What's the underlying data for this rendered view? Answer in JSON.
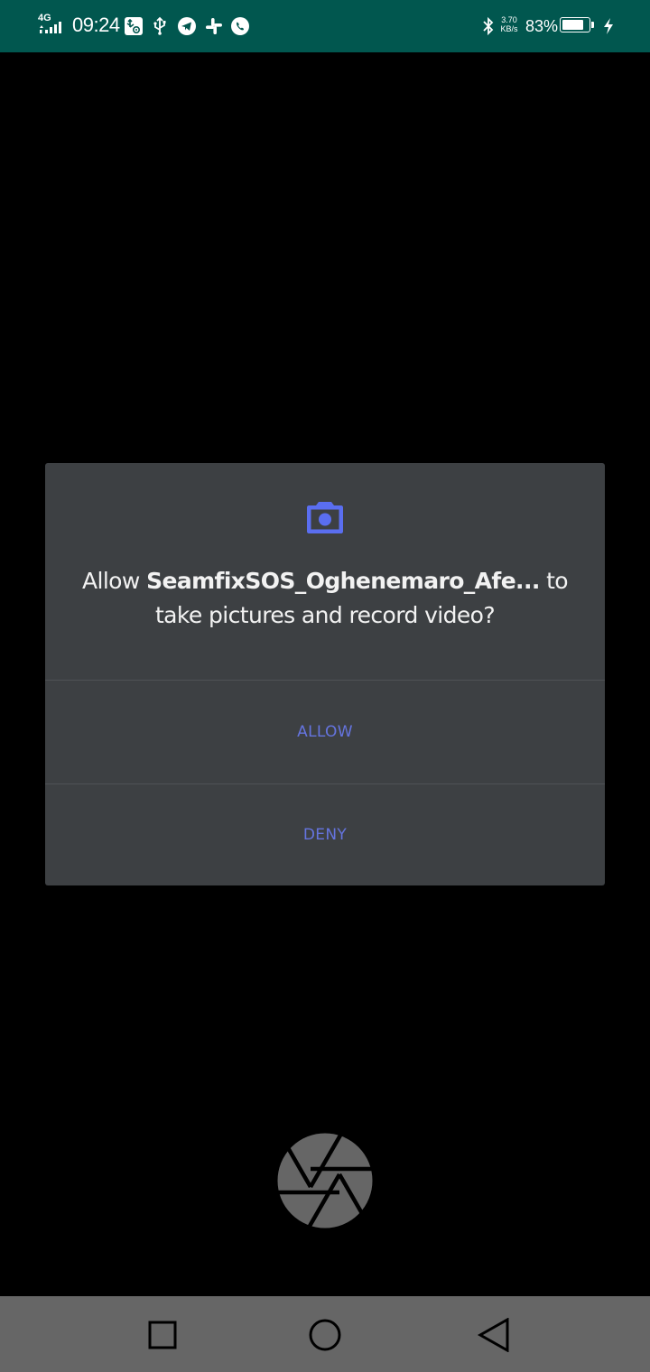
{
  "status_bar": {
    "network_type": "4G",
    "time": "09:24",
    "net_speed_value": "3.70",
    "net_speed_unit": "KB/s",
    "battery_percent": "83%",
    "battery_level": 0.83,
    "background_color": "#01574f",
    "notification_icons": [
      "usb-settings-icon",
      "usb-icon",
      "telegram-icon",
      "slack-icon",
      "whatsapp-icon"
    ],
    "system_icons": [
      "bluetooth-icon",
      "battery-icon",
      "charging-icon"
    ]
  },
  "dialog": {
    "message_prefix": "Allow ",
    "app_name": "SeamfixSOS_Oghenemaro_Afe...",
    "message_suffix": " to take pictures and record video?",
    "allow_label": "ALLOW",
    "deny_label": "DENY",
    "icon": "camera-icon",
    "accent_color": "#5a6ef0",
    "background_color": "#3d4043"
  },
  "camera": {
    "shutter_icon": "camera-shutter-icon"
  },
  "nav_bar": {
    "buttons": [
      "recents-square-icon",
      "home-circle-icon",
      "back-triangle-icon"
    ],
    "background_color": "#666666"
  }
}
